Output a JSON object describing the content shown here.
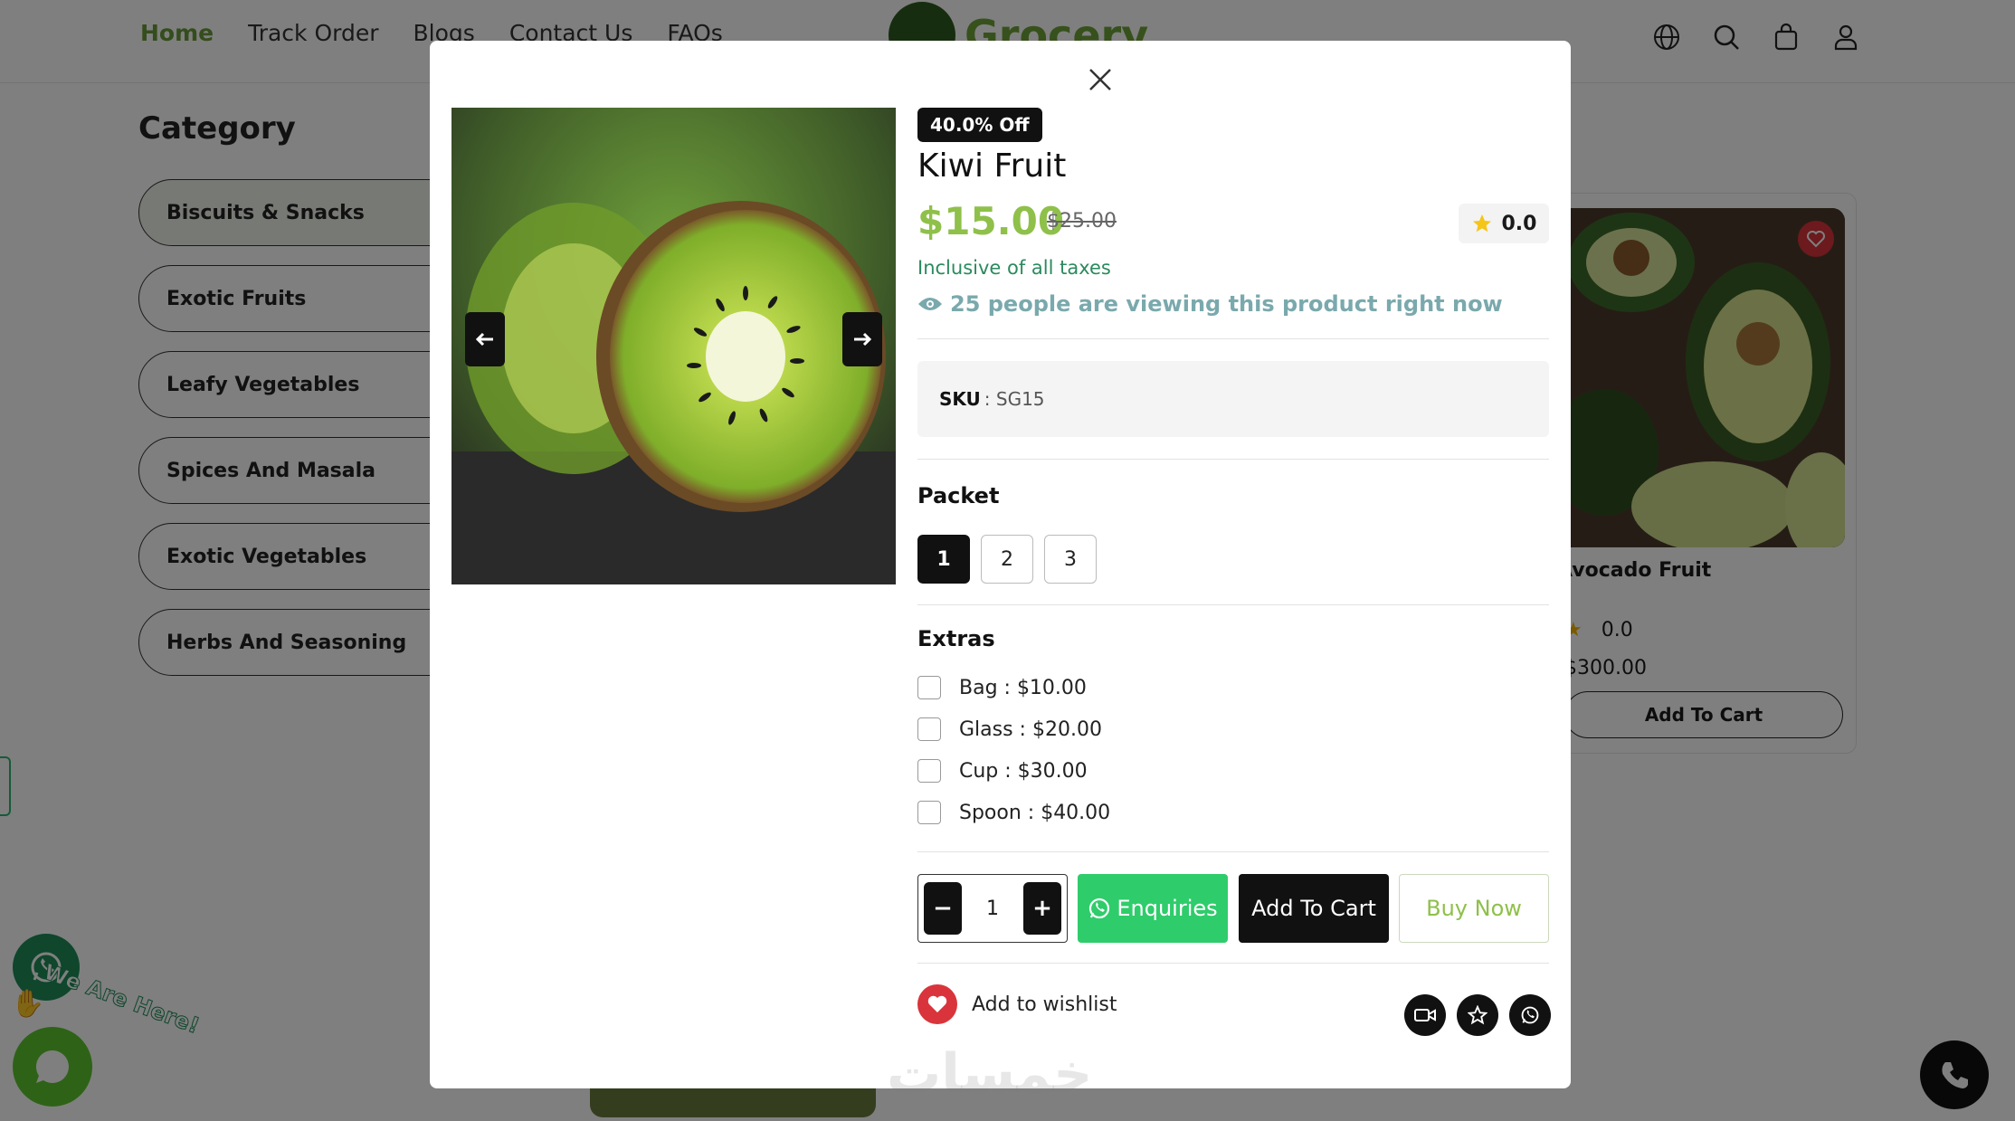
{
  "nav": {
    "items": [
      "Home",
      "Track Order",
      "Blogs",
      "Contact Us",
      "FAQs"
    ],
    "brand": "Grocery"
  },
  "sidebar": {
    "title": "Category",
    "items": [
      "Biscuits & Snacks",
      "Exotic Fruits",
      "Leafy Vegetables",
      "Spices And Masala",
      "Exotic Vegetables",
      "Herbs And Seasoning"
    ]
  },
  "bg_product": {
    "name": "Avocado Fruit",
    "rating": "0.0",
    "price": "$300.00",
    "add_label": "Add To Cart"
  },
  "floating": {
    "we_are_here": "We Are Here!"
  },
  "modal": {
    "discount_badge": "40.0% Off",
    "title": "Kiwi Fruit",
    "price": "$15.00",
    "old_price": "$25.00",
    "rating": "0.0",
    "taxes_note": "Inclusive of all taxes",
    "viewers_note": "25 people are viewing this product right now",
    "sku_label": "SKU",
    "sku_value": ": SG15",
    "packet_label": "Packet",
    "packets": [
      "1",
      "2",
      "3"
    ],
    "selected_packet": "1",
    "extras_label": "Extras",
    "extras": [
      "Bag : $10.00",
      "Glass : $20.00",
      "Cup : $30.00",
      "Spoon : $40.00"
    ],
    "quantity": "1",
    "enquiries_label": "Enquiries",
    "add_to_cart_label": "Add To Cart",
    "buy_now_label": "Buy Now",
    "wishlist_label": "Add to wishlist"
  },
  "watermark": "خمسات",
  "colors": {
    "accent_green": "#8fc04a",
    "whatsapp_green": "#2fcc6b",
    "heart_red": "#d9343b",
    "viewer_teal": "#7aa9ad"
  },
  "icons": [
    "globe-icon",
    "search-icon",
    "bag-icon",
    "user-icon",
    "close-icon",
    "arrow-left-icon",
    "arrow-right-icon",
    "star-icon",
    "eye-icon",
    "whatsapp-icon",
    "heart-icon",
    "video-icon",
    "phone-icon",
    "chat-icon"
  ]
}
